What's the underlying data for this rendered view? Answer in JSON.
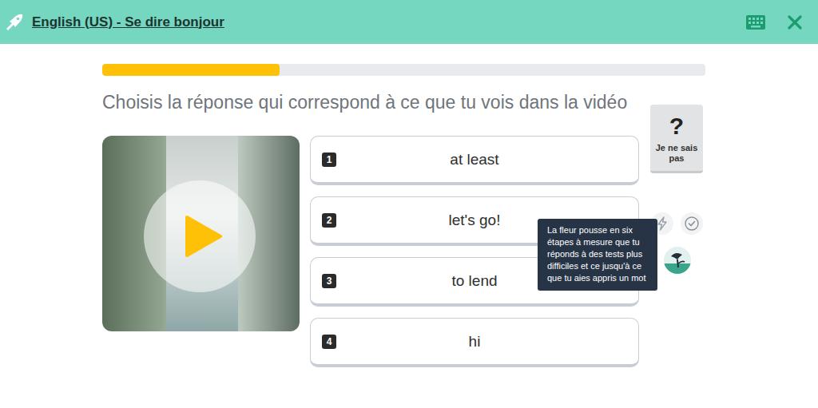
{
  "header": {
    "title": "English (US) - Se dire bonjour"
  },
  "progress": {
    "level": 0.294
  },
  "question": "Choisis la réponse qui correspond à ce que tu vois dans la vidéo",
  "options": [
    {
      "number": "1",
      "label": "at least",
      "selected": false
    },
    {
      "number": "2",
      "label": "let's go!",
      "selected": false
    },
    {
      "number": "3",
      "label": "to lend",
      "selected": false
    },
    {
      "number": "4",
      "label": "hi",
      "selected": false
    }
  ],
  "dont_know": {
    "icon": "?",
    "label": "Je ne sais pas"
  },
  "tooltip": {
    "text": "La fleur pousse en six étapes à mesure que tu réponds à des tests plus difficiles et ce jusqu'à ce que tu aies appris un mot"
  }
}
